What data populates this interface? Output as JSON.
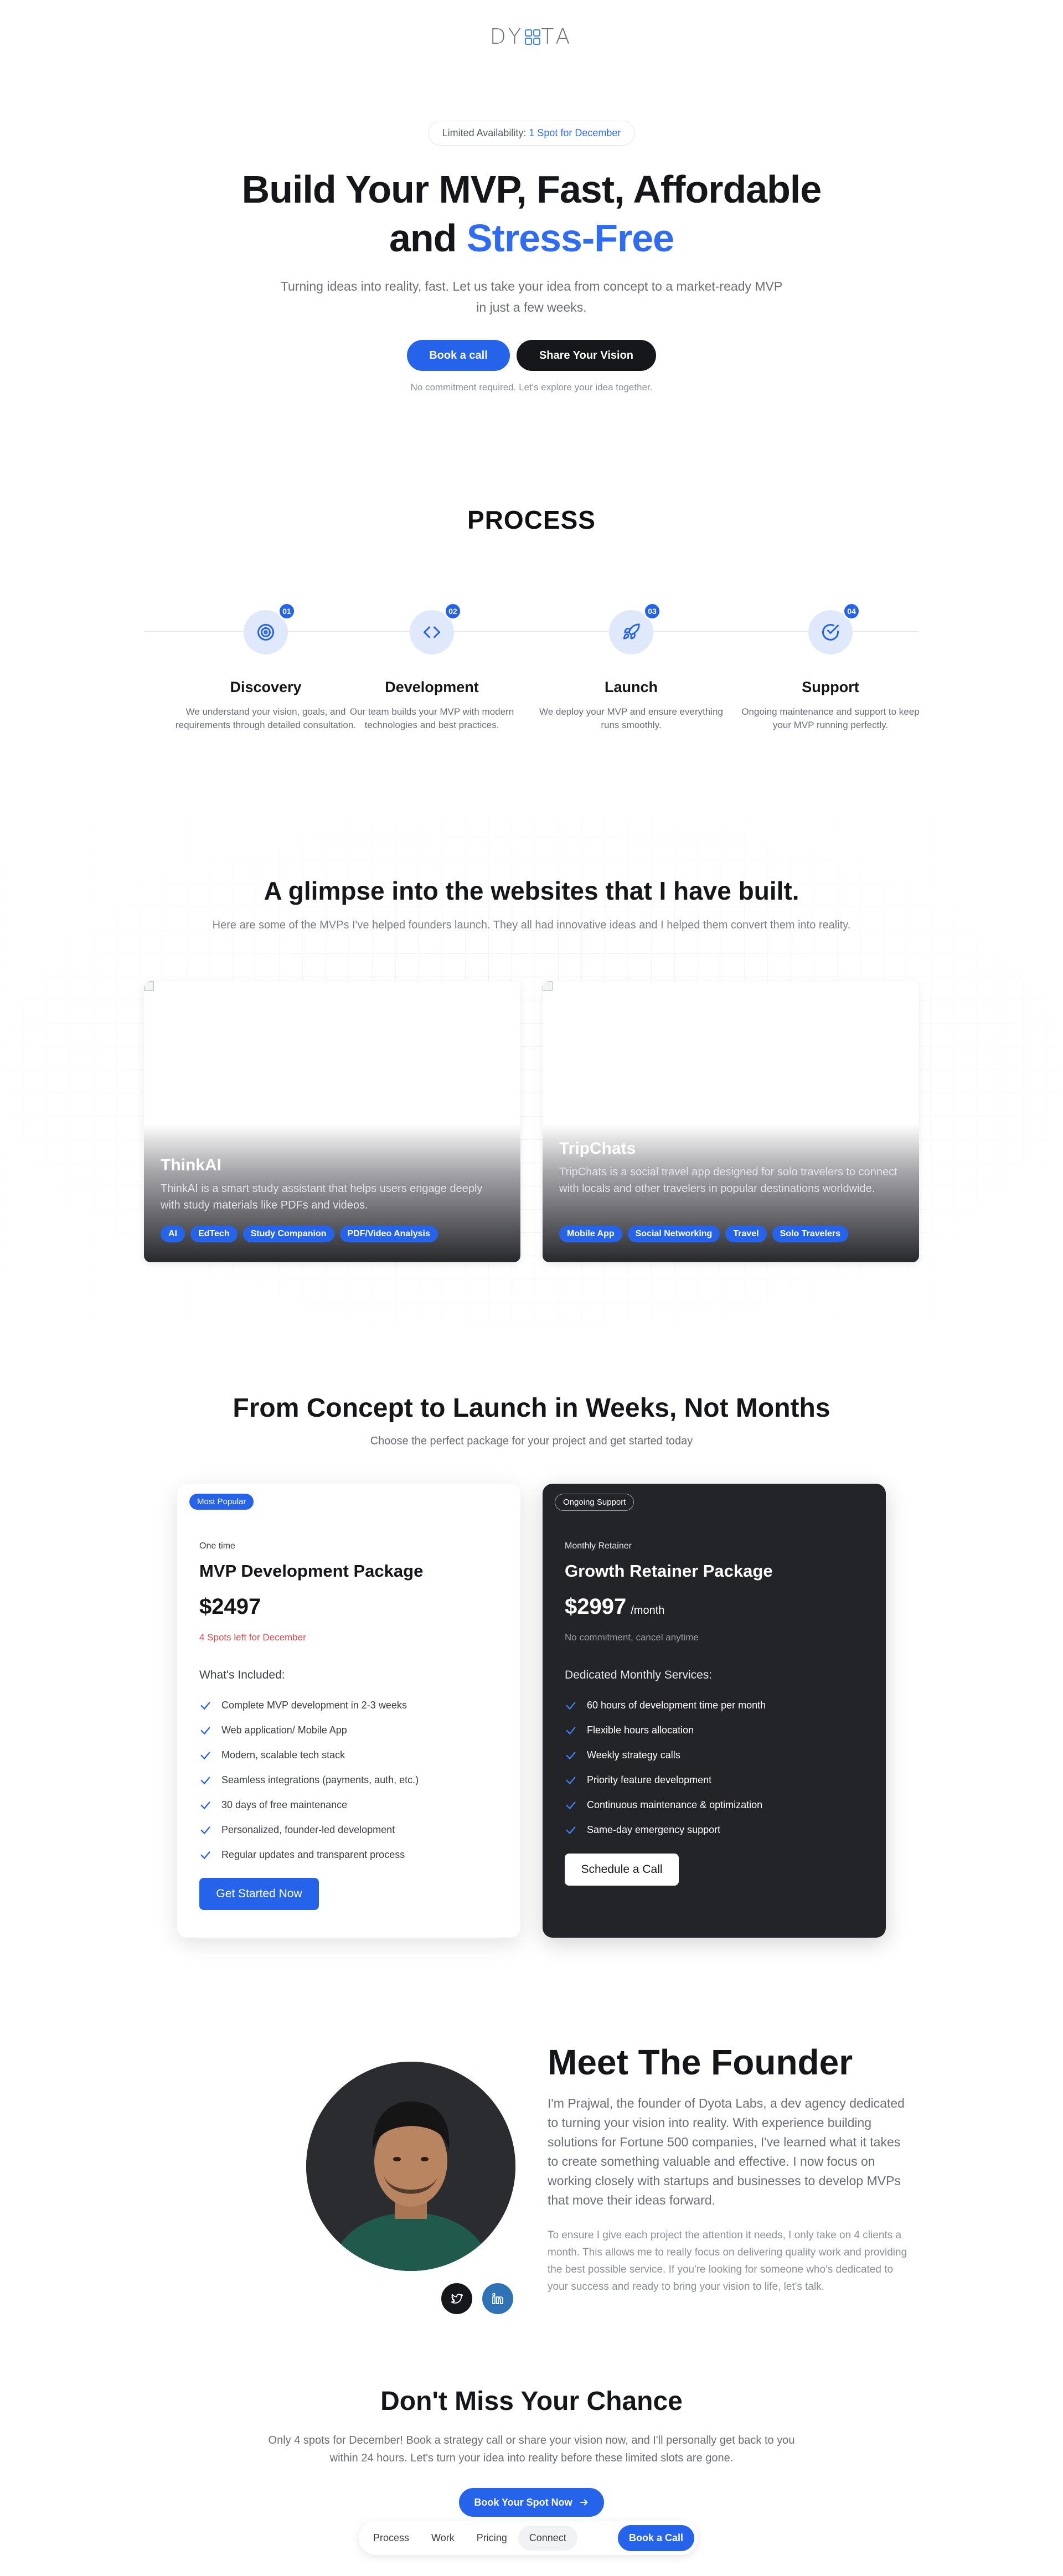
{
  "brand": {
    "logo_left": "DY",
    "logo_mid": "O",
    "logo_right": "TA"
  },
  "hero": {
    "availability_label": "Limited Availability:",
    "availability_value": "1 Spot for December",
    "title_line1": "Build Your MVP, Fast, Affordable",
    "title_line2_prefix": "and",
    "title_line2_highlight": "Stress-Free",
    "subtitle": "Turning ideas into reality, fast. Let us take your idea from concept to a market-ready MVP in just a few weeks.",
    "primary_button": "Book a call",
    "secondary_button": "Share Your Vision",
    "note": "No commitment required. Let's explore your idea together."
  },
  "process": {
    "title": "PROCESS",
    "steps": [
      {
        "num": "01",
        "icon": "target-icon",
        "title": "Discovery",
        "desc": "We understand your vision, goals, and requirements through detailed consultation."
      },
      {
        "num": "02",
        "icon": "code-icon",
        "title": "Development",
        "desc": "Our team builds your MVP with modern technologies and best practices."
      },
      {
        "num": "03",
        "icon": "rocket-icon",
        "title": "Launch",
        "desc": "We deploy your MVP and ensure everything runs smoothly."
      },
      {
        "num": "04",
        "icon": "check-circle-icon",
        "title": "Support",
        "desc": "Ongoing maintenance and support to keep your MVP running perfectly."
      }
    ]
  },
  "portfolio": {
    "title": "A glimpse into the websites that I have built.",
    "subtitle": "Here are some of the MVPs I've helped founders launch. They all had innovative ideas and I helped them convert them into reality.",
    "projects": [
      {
        "title": "ThinkAI",
        "desc": "ThinkAI is a smart study assistant that helps users engage deeply with study materials like PDFs and videos.",
        "tags": [
          "AI",
          "EdTech",
          "Study Companion",
          "PDF/Video Analysis"
        ]
      },
      {
        "title": "TripChats",
        "desc": "TripChats is a social travel app designed for solo travelers to connect with locals and other travelers in popular destinations worldwide.",
        "tags": [
          "Mobile App",
          "Social Networking",
          "Travel",
          "Solo Travelers"
        ]
      }
    ]
  },
  "pricing": {
    "title": "From Concept to Launch in Weeks, Not Months",
    "subtitle": "Choose the perfect package for your project and get started today",
    "plans": [
      {
        "badge": "Most Popular",
        "kind": "One time",
        "name": "MVP Development Package",
        "price": "$2497",
        "price_suffix": "",
        "note": "4 Spots left for December",
        "included_label": "What's Included:",
        "features": [
          "Complete MVP development in 2-3 weeks",
          "Web application/ Mobile App",
          "Modern, scalable tech stack",
          "Seamless integrations (payments, auth, etc.)",
          "30 days of free maintenance",
          "Personalized, founder-led development",
          "Regular updates and transparent process"
        ],
        "button": "Get Started Now"
      },
      {
        "badge": "Ongoing Support",
        "kind": "Monthly Retainer",
        "name": "Growth Retainer Package",
        "price": "$2997",
        "price_suffix": "/month",
        "note": "No commitment, cancel anytime",
        "included_label": "Dedicated Monthly Services:",
        "features": [
          "60 hours of development time per month",
          "Flexible hours allocation",
          "Weekly strategy calls",
          "Priority feature development",
          "Continuous maintenance & optimization",
          "Same-day emergency support"
        ],
        "button": "Schedule a Call"
      }
    ]
  },
  "founder": {
    "title": "Meet The Founder",
    "p1": "I'm Prajwal, the founder of Dyota Labs, a dev agency dedicated to turning your vision into reality. With experience building solutions for Fortune 500 companies, I've learned what it takes to create something valuable and effective. I now focus on working closely with startups and businesses to develop MVPs that move their ideas forward.",
    "p2": "To ensure I give each project the attention it needs, I only take on 4 clients a month. This allows me to really focus on delivering quality work and providing the best possible service. If you're looking for someone who's dedicated to your success and ready to bring your vision to life, let's talk."
  },
  "cta": {
    "title": "Don't Miss Your Chance",
    "subtitle": "Only 4 spots for December! Book a strategy call or share your vision now, and I'll personally get back to you within 24 hours. Let's turn your idea into reality before these limited slots are gone.",
    "button": "Book Your Spot Now"
  },
  "nav": {
    "items": [
      "Process",
      "Work",
      "Pricing",
      "Connect"
    ],
    "cta": "Book a Call"
  },
  "colors": {
    "accent": "#2563eb",
    "dark": "#16171b",
    "alert": "#e5484d"
  }
}
